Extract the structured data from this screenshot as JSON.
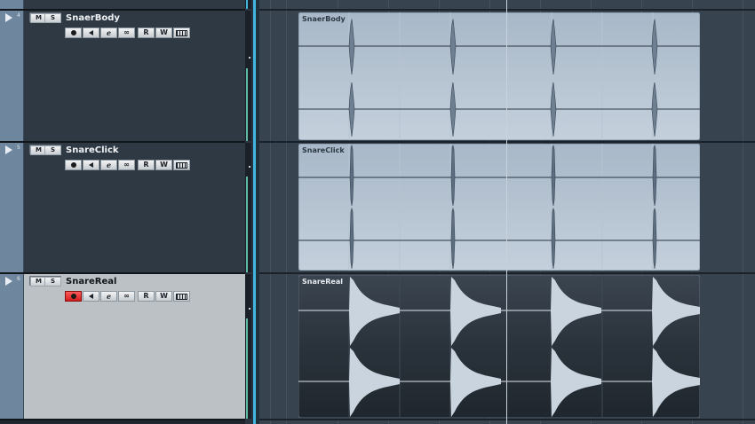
{
  "tracks": [
    {
      "number": "4",
      "name": "SnaerBody",
      "selected": false,
      "record_armed": false
    },
    {
      "number": "5",
      "name": "SnareClick",
      "selected": false,
      "record_armed": false
    },
    {
      "number": "6",
      "name": "SnareReal",
      "selected": true,
      "record_armed": true
    }
  ],
  "buttons": {
    "mute": "M",
    "solo": "S",
    "read": "R",
    "write": "W"
  },
  "icons": [
    "disclosure-triangle-icon",
    "record-icon",
    "monitor-speaker-icon",
    "edit-e-icon",
    "link-icon",
    "read-automation-icon",
    "write-automation-icon",
    "lanes-icon"
  ],
  "colors": {
    "track_panel": "#2e3944",
    "selected_track_panel": "#bcc1c5",
    "event_light": "#a9b9c9",
    "event_dark": "#2a323b",
    "record_active": "#e62a2a",
    "meter": "#5fb8a0",
    "cursor": "#c9d2db"
  },
  "events": [
    {
      "name": "SnaerBody",
      "style": "light"
    },
    {
      "name": "SnareClick",
      "style": "light"
    },
    {
      "name": "SnareReal",
      "style": "dark"
    }
  ]
}
